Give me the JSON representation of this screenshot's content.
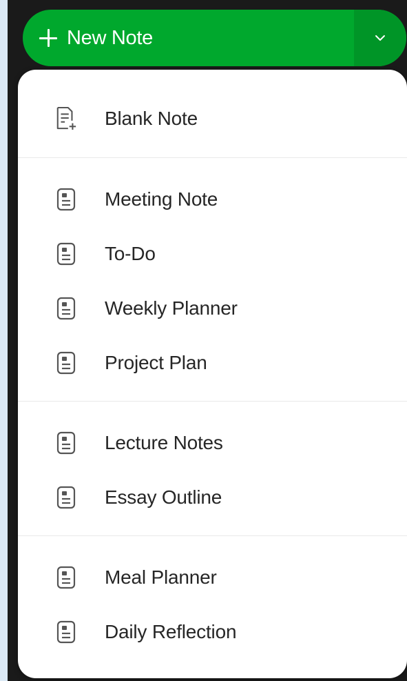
{
  "new_note_button": {
    "label": "New Note",
    "icon": "plus-icon",
    "dropdown_icon": "chevron-down-icon",
    "color": "#00a82d"
  },
  "menu": {
    "groups": [
      {
        "items": [
          {
            "label": "Blank Note",
            "icon": "blank-note-icon"
          }
        ]
      },
      {
        "items": [
          {
            "label": "Meeting Note",
            "icon": "template-icon"
          },
          {
            "label": "To-Do",
            "icon": "template-icon"
          },
          {
            "label": "Weekly Planner",
            "icon": "template-icon"
          },
          {
            "label": "Project Plan",
            "icon": "template-icon"
          }
        ]
      },
      {
        "items": [
          {
            "label": "Lecture Notes",
            "icon": "template-icon"
          },
          {
            "label": "Essay Outline",
            "icon": "template-icon"
          }
        ]
      },
      {
        "items": [
          {
            "label": "Meal Planner",
            "icon": "template-icon"
          },
          {
            "label": "Daily Reflection",
            "icon": "template-icon"
          }
        ]
      }
    ]
  }
}
